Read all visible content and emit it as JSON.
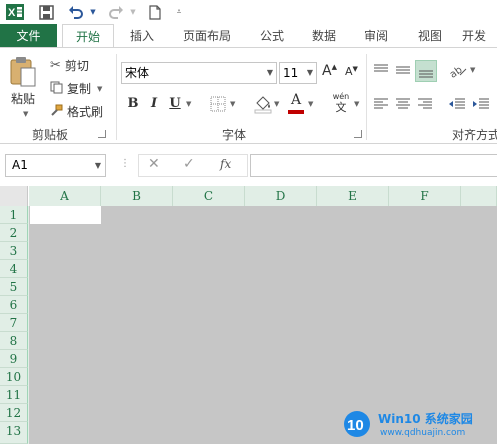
{
  "qat": {
    "app_icon": "excel-logo",
    "save_icon": "save-icon",
    "undo_icon": "undo-icon",
    "redo_icon": "redo-icon",
    "new_icon": "new-document-icon",
    "more_icon": "customize-qat-icon"
  },
  "tabs": [
    {
      "label": "文件"
    },
    {
      "label": "开始"
    },
    {
      "label": "插入"
    },
    {
      "label": "页面布局"
    },
    {
      "label": "公式"
    },
    {
      "label": "数据"
    },
    {
      "label": "审阅"
    },
    {
      "label": "视图"
    },
    {
      "label": "开发"
    }
  ],
  "clipboard": {
    "paste_label": "粘贴",
    "cut_label": "剪切",
    "copy_label": "复制",
    "format_painter_label": "格式刷",
    "group_label": "剪贴板"
  },
  "font": {
    "name": "宋体",
    "size": "11",
    "grow": "A",
    "shrink": "A",
    "bold": "B",
    "italic": "I",
    "underline": "U",
    "font_color_letter": "A",
    "phonetic_top": "wén",
    "phonetic_bottom": "文",
    "group_label": "字体",
    "font_color": "#c00000"
  },
  "alignment": {
    "group_label": "对齐方式"
  },
  "formula_bar": {
    "name_box": "A1",
    "fx_label": "fx",
    "cancel_icon": "cancel-icon",
    "enter_icon": "enter-icon",
    "formula": ""
  },
  "grid": {
    "columns": [
      "A",
      "B",
      "C",
      "D",
      "E",
      "F"
    ],
    "rows": [
      "1",
      "2",
      "3",
      "4",
      "5",
      "6",
      "7",
      "8",
      "9",
      "10",
      "11",
      "12",
      "13"
    ],
    "selected_cell": "A1",
    "header_color": "#217346"
  },
  "watermark": {
    "logo_text": "10",
    "title": "Win10 系统家园",
    "url": "www.qdhuajin.com"
  }
}
